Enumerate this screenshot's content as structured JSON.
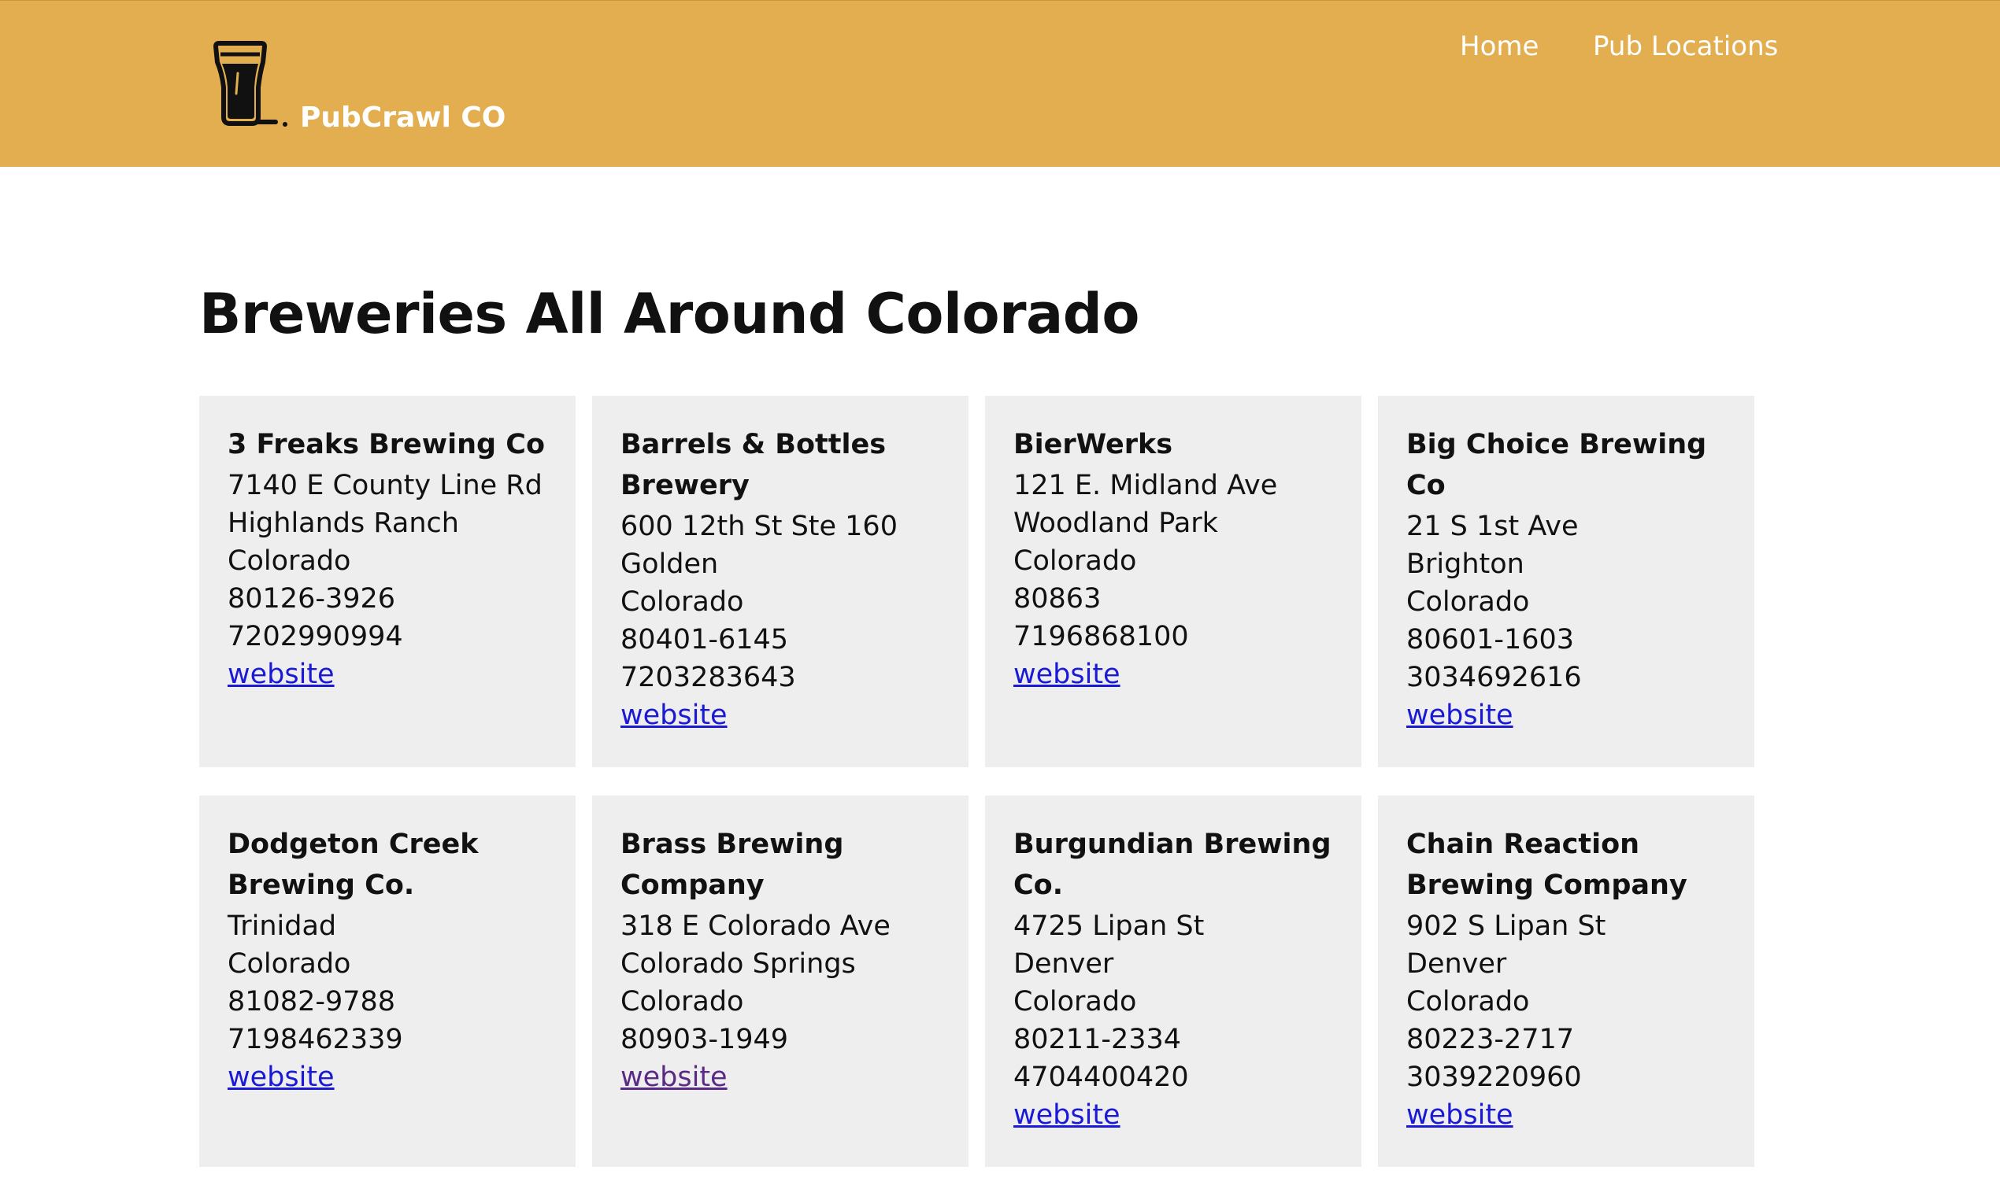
{
  "header": {
    "brand": "PubCrawl CO",
    "logo_icon": "beer-glass-icon",
    "background_color": "#e2ae4f",
    "nav": [
      {
        "label": "Home"
      },
      {
        "label": "Pub Locations"
      }
    ]
  },
  "main": {
    "title": "Breweries All Around Colorado",
    "card_background": "#eeeeee",
    "link_color": "#1a1ad6",
    "visited_link_color": "#5b2a86",
    "breweries": [
      {
        "name": "3 Freaks Brewing Co",
        "lines": [
          "7140 E County Line Rd",
          "Highlands Ranch",
          "Colorado",
          "80126-3926",
          "7202990994"
        ],
        "link": "website"
      },
      {
        "name": "Barrels & Bottles Brewery",
        "lines": [
          "600 12th St Ste 160",
          "Golden",
          "Colorado",
          "80401-6145",
          "7203283643"
        ],
        "link": "website"
      },
      {
        "name": "BierWerks",
        "lines": [
          "121 E. Midland Ave",
          "Woodland Park",
          "Colorado",
          "80863",
          "7196868100"
        ],
        "link": "website"
      },
      {
        "name": "Big Choice Brewing Co",
        "lines": [
          "21 S 1st Ave",
          "Brighton",
          "Colorado",
          "80601-1603",
          "3034692616"
        ],
        "link": "website"
      },
      {
        "name": "Dodgeton Creek Brewing Co.",
        "lines": [
          "Trinidad",
          "Colorado",
          "81082-9788",
          "7198462339"
        ],
        "link": "website"
      },
      {
        "name": "Brass Brewing Company",
        "lines": [
          "318 E Colorado Ave",
          "Colorado Springs",
          "Colorado",
          "80903-1949"
        ],
        "link": "website",
        "visited": true
      },
      {
        "name": "Burgundian Brewing Co.",
        "lines": [
          "4725 Lipan St",
          "Denver",
          "Colorado",
          "80211-2334",
          "4704400420"
        ],
        "link": "website"
      },
      {
        "name": "Chain Reaction Brewing Company",
        "lines": [
          "902 S Lipan St",
          "Denver",
          "Colorado",
          "80223-2717",
          "3039220960"
        ],
        "link": "website"
      }
    ]
  }
}
